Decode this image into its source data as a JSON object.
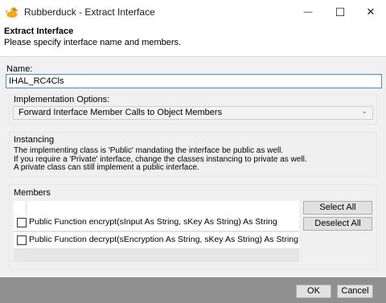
{
  "window": {
    "title": "Rubberduck - Extract Interface",
    "minimize_glyph": "—",
    "maximize_glyph": "☐",
    "close_glyph": "✕"
  },
  "header": {
    "title": "Extract Interface",
    "subtitle": "Please specify interface name and members."
  },
  "name": {
    "label": "Name:",
    "value": "IHAL_RC4Cls"
  },
  "implementation": {
    "label": "Implementation Options:",
    "selected": "Forward Interface Member Calls to Object Members"
  },
  "instancing": {
    "label": "Instancing",
    "lines": [
      "The implementing class is 'Public' mandating the interface be public as well.",
      "If you require a 'Private' interface, change the classes instancing to private as well.",
      "A private class can still implement a public interface."
    ]
  },
  "members": {
    "label": "Members",
    "rows": [
      {
        "text": "Public Function encrypt(sInput As String, sKey As String) As String",
        "checked": false
      },
      {
        "text": "Public Function decrypt(sEncryption As String, sKey As String) As String",
        "checked": false
      }
    ],
    "select_all": "Select All",
    "deselect_all": "Deselect All"
  },
  "footer": {
    "ok": "OK",
    "cancel": "Cancel"
  },
  "colors": {
    "accent_border": "#3d8fd6",
    "footer_bg": "#909090",
    "duck": "#f0a91e"
  }
}
